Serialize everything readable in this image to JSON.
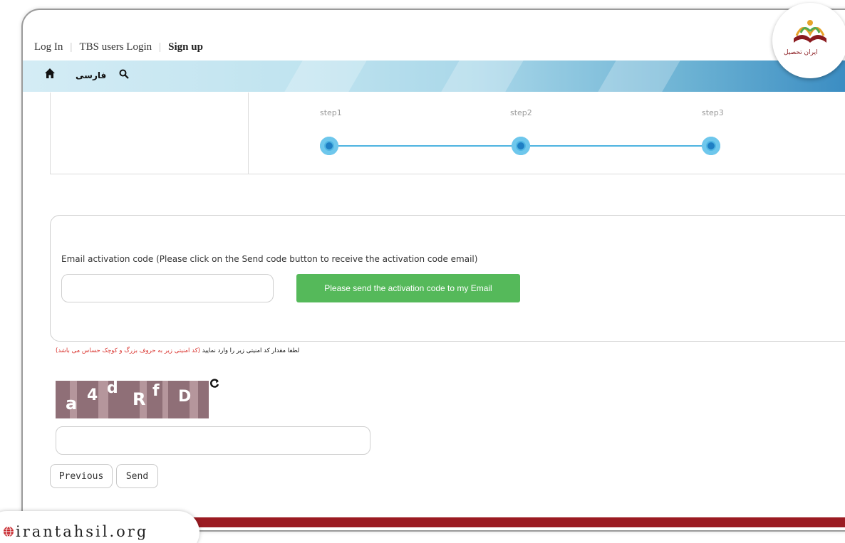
{
  "topnav": {
    "login": "Log In",
    "tbs_login": "TBS users Login",
    "signup": "Sign up"
  },
  "bluebar": {
    "home_icon": "home-icon",
    "language": "فارسی",
    "search_icon": "search-icon"
  },
  "steps": [
    {
      "label": "step1"
    },
    {
      "label": "step2"
    },
    {
      "label": "step3"
    }
  ],
  "email": {
    "label": "Email activation code (Please click on the Send code button to receive the activation code email)",
    "input_value": "",
    "send_button": "Please send the activation code to my Email"
  },
  "captcha": {
    "note_black": "لطفا مقدار کد امنیتی زیر را وارد نمایید",
    "note_red": "(کد امنیتی زیر به حروف بزرگ و کوچک حساس می باشد)",
    "image_text": "a4dRfD",
    "refresh_icon": "refresh-icon",
    "input_value": ""
  },
  "buttons": {
    "previous": "Previous",
    "send": "Send"
  },
  "logo": {
    "text": "ایران تحصیل"
  },
  "watermark": {
    "text": "irantahsil.org",
    "icon": "globe-icon"
  },
  "colors": {
    "accent_green": "#55b95a",
    "step_blue": "#4fb6e3",
    "brand_red": "#9b1b22",
    "captcha_bg": "#8f6f77"
  }
}
